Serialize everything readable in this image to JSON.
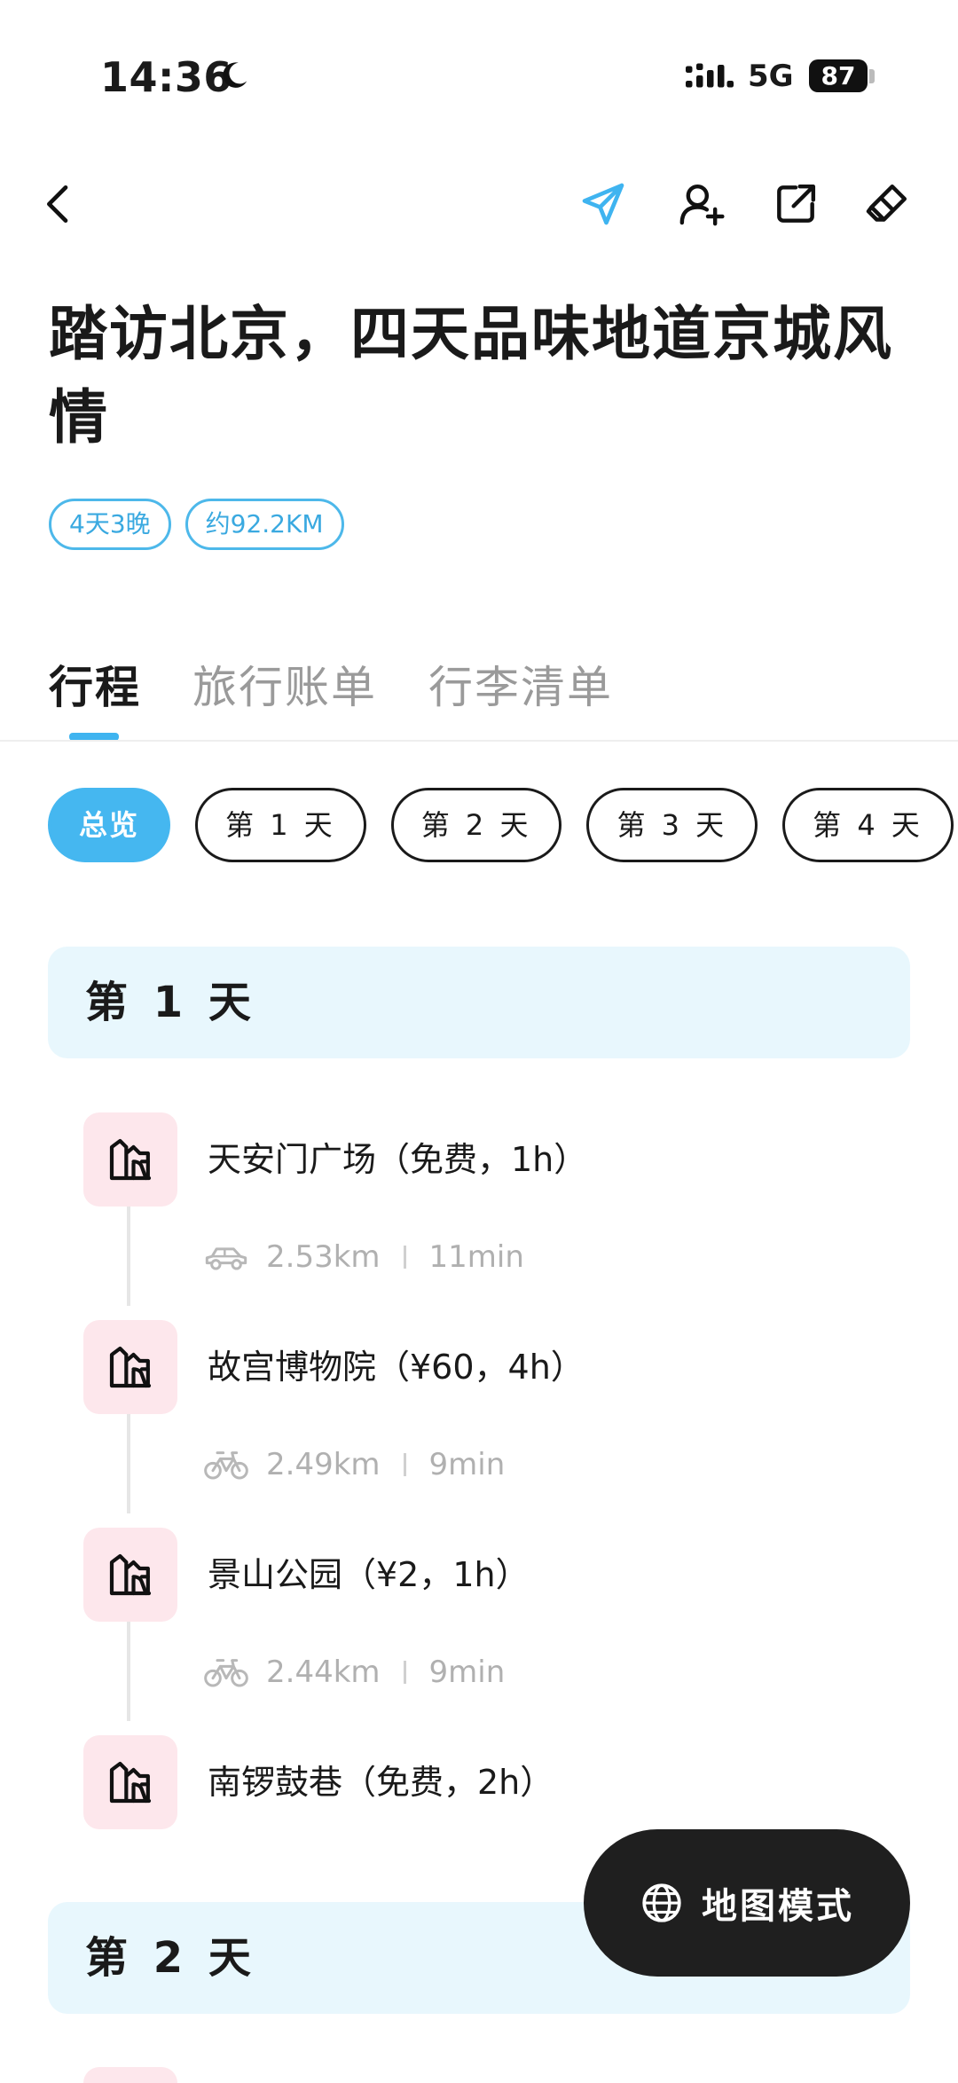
{
  "status_bar": {
    "time": "14:36",
    "network": "5G",
    "battery": "87"
  },
  "trip": {
    "title": "踏访北京，四天品味地道京城风情",
    "tags": [
      "4天3晚",
      "约92.2KM"
    ]
  },
  "tabs": [
    {
      "label": "行程",
      "active": true
    },
    {
      "label": "旅行账单",
      "active": false
    },
    {
      "label": "行李清单",
      "active": false
    }
  ],
  "chips": {
    "overview": "总览",
    "days": [
      "第 1 天",
      "第 2 天",
      "第 3 天",
      "第 4 天"
    ],
    "add": "+"
  },
  "days": [
    {
      "label": "第 1 天",
      "stops": [
        {
          "name": "天安门广场（免费，1h）"
        },
        {
          "name": "故宫博物院（¥60，4h）"
        },
        {
          "name": "景山公园（¥2，1h）"
        },
        {
          "name": "南锣鼓巷（免费，2h）"
        }
      ],
      "legs": [
        {
          "mode_icon": "car-icon",
          "distance": "2.53km",
          "duration": "11min"
        },
        {
          "mode_icon": "bike-icon",
          "distance": "2.49km",
          "duration": "9min"
        },
        {
          "mode_icon": "bike-icon",
          "distance": "2.44km",
          "duration": "9min"
        }
      ]
    },
    {
      "label": "第 2 天"
    }
  ],
  "map_button": {
    "label": "地图模式",
    "icon": "globe-icon"
  },
  "colors": {
    "accent": "#45b7f0",
    "stop_icon_bg": "#fde7ec",
    "day_header_bg": "#e8f7fd",
    "map_button_bg": "#1f1f1f"
  }
}
